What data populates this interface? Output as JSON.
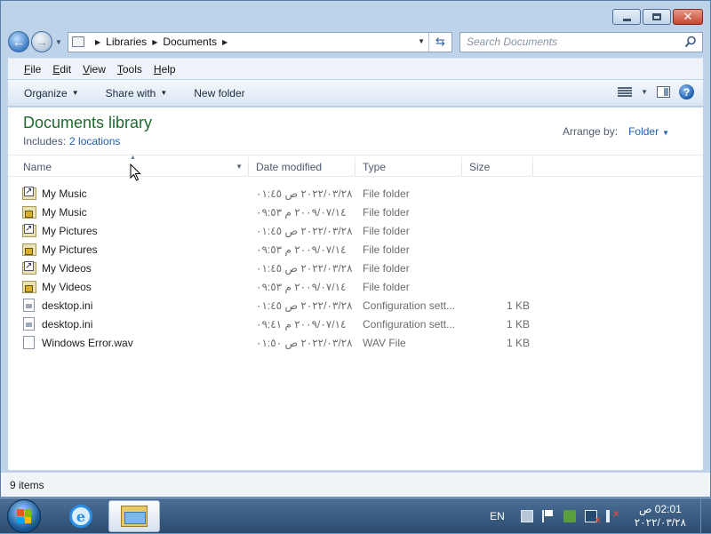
{
  "window": {
    "caption": {
      "minimize": "",
      "maximize": "",
      "close": "✕"
    }
  },
  "address": {
    "crumbs": [
      "Libraries",
      "Documents"
    ],
    "search_placeholder": "Search Documents"
  },
  "menu": [
    "File",
    "Edit",
    "View",
    "Tools",
    "Help"
  ],
  "commands": {
    "organize": "Organize",
    "share_with": "Share with",
    "new_folder": "New folder"
  },
  "library": {
    "title": "Documents library",
    "includes_label": "Includes:",
    "locations": "2 locations",
    "arrange_label": "Arrange by:",
    "arrange_value": "Folder"
  },
  "columns": {
    "name": "Name",
    "date": "Date modified",
    "type": "Type",
    "size": "Size"
  },
  "files": [
    {
      "icon": "folder-link",
      "name": "My Music",
      "date": "٢٠٢٢/٠٣/٢٨ ص ٠١:٤٥",
      "type": "File folder",
      "size": ""
    },
    {
      "icon": "folder-lock",
      "name": "My Music",
      "date": "٢٠٠٩/٠٧/١٤ م ٠٩:٥٣",
      "type": "File folder",
      "size": ""
    },
    {
      "icon": "folder-link",
      "name": "My Pictures",
      "date": "٢٠٢٢/٠٣/٢٨ ص ٠١:٤٥",
      "type": "File folder",
      "size": ""
    },
    {
      "icon": "folder-lock",
      "name": "My Pictures",
      "date": "٢٠٠٩/٠٧/١٤ م ٠٩:٥٣",
      "type": "File folder",
      "size": ""
    },
    {
      "icon": "folder-link",
      "name": "My Videos",
      "date": "٢٠٢٢/٠٣/٢٨ ص ٠١:٤٥",
      "type": "File folder",
      "size": ""
    },
    {
      "icon": "folder-lock",
      "name": "My Videos",
      "date": "٢٠٠٩/٠٧/١٤ م ٠٩:٥٣",
      "type": "File folder",
      "size": ""
    },
    {
      "icon": "config",
      "name": "desktop.ini",
      "date": "٢٠٢٢/٠٣/٢٨ ص ٠١:٤٥",
      "type": "Configuration sett...",
      "size": "1 KB"
    },
    {
      "icon": "config",
      "name": "desktop.ini",
      "date": "٢٠٠٩/٠٧/١٤ م ٠٩:٤١",
      "type": "Configuration sett...",
      "size": "1 KB"
    },
    {
      "icon": "wav",
      "name": "Windows Error.wav",
      "date": "٢٠٢٢/٠٣/٢٨ ص ٠١:٥٠",
      "type": "WAV File",
      "size": "1 KB"
    }
  ],
  "status": {
    "items": "9 items"
  },
  "taskbar": {
    "lang": "EN",
    "time": "02:01 ص",
    "date": "٢٠٢٢/٠٣/٢٨"
  },
  "colors": {
    "title_green": "#1e6a2f",
    "link_blue": "#1e5fb3",
    "taskbar": "#2c4b6e"
  }
}
